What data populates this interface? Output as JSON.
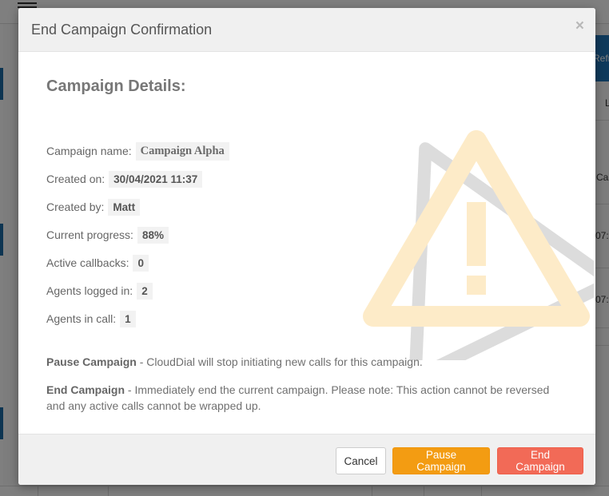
{
  "background": {
    "refresh_label": "Refr",
    "column_letter": "L",
    "row_cells": [
      "Ca",
      "07:",
      "07:"
    ]
  },
  "modal": {
    "title": "End Campaign Confirmation",
    "close_symbol": "×",
    "details_heading": "Campaign Details:",
    "details": [
      {
        "label": "Campaign name:",
        "value": "Campaign Alpha"
      },
      {
        "label": "Created on:",
        "value": "30/04/2021 11:37"
      },
      {
        "label": "Created by:",
        "value": "Matt"
      },
      {
        "label": "Current progress:",
        "value": "88%"
      },
      {
        "label": "Active callbacks:",
        "value": "0"
      },
      {
        "label": "Agents logged in:",
        "value": "2"
      },
      {
        "label": "Agents in call:",
        "value": "1"
      }
    ],
    "pause_note": {
      "title": "Pause Campaign",
      "text": " - CloudDial will stop initiating new calls for this campaign."
    },
    "end_note": {
      "title": "End Campaign",
      "text": " - Immediately end the current campaign. Please note: This action cannot be reversed and any active calls cannot be wrapped up."
    },
    "buttons": {
      "cancel": "Cancel",
      "pause": "Pause Campaign",
      "end": "End Campaign"
    }
  },
  "icons": {
    "warning": "warning-triangle-icon",
    "close": "close-icon",
    "menu": "hamburger-menu-icon"
  },
  "colors": {
    "pause_button": "#f39c12",
    "end_button": "#f26a57",
    "warning_outline": "#d9d9d9",
    "warning_inner": "#fdebc8"
  }
}
